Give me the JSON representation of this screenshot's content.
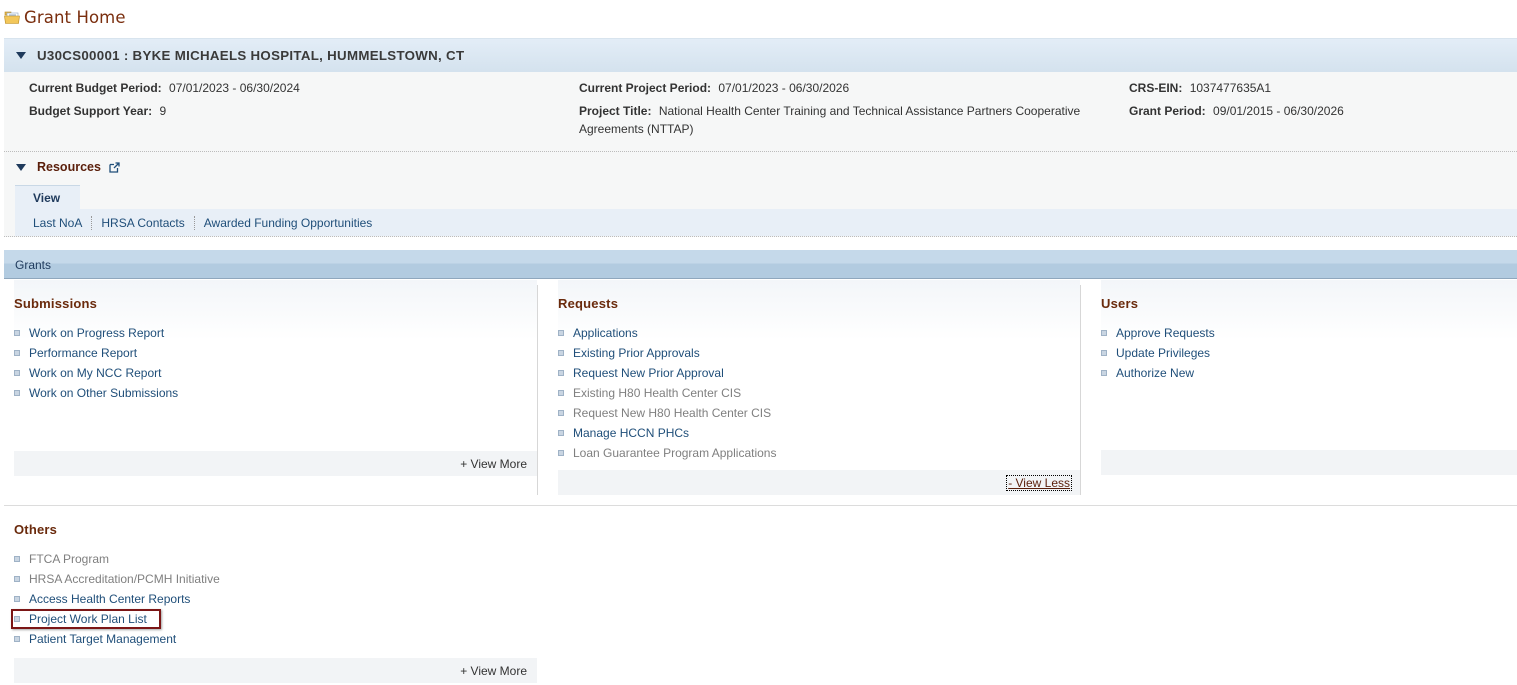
{
  "page": {
    "title": "Grant Home",
    "icon": "folder-icon"
  },
  "grant": {
    "title": "U30CS00001 : BYKE MICHAELS HOSPITAL, HUMMELSTOWN, CT",
    "details": {
      "current_budget_period": {
        "label": "Current Budget Period:",
        "value": "07/01/2023 - 06/30/2024"
      },
      "budget_support_year": {
        "label": "Budget Support Year:",
        "value": "9"
      },
      "current_project_period": {
        "label": "Current Project Period:",
        "value": "07/01/2023 - 06/30/2026"
      },
      "project_title": {
        "label": "Project Title:",
        "value": "National Health Center Training and Technical Assistance Partners Cooperative",
        "value_line2": "Agreements (NTTAP)"
      },
      "crs_ein": {
        "label": "CRS-EIN:",
        "value": "1037477635A1"
      },
      "grant_period": {
        "label": "Grant Period:",
        "value": "09/01/2015 - 06/30/2026"
      }
    }
  },
  "resources": {
    "label": "Resources",
    "tab": "View",
    "links": [
      "Last NoA",
      "HRSA Contacts",
      "Awarded Funding Opportunities"
    ]
  },
  "grants": {
    "bar_label": "Grants",
    "submissions": {
      "heading": "Submissions",
      "items": [
        {
          "label": "Work on Progress Report",
          "enabled": true
        },
        {
          "label": "Performance Report",
          "enabled": true
        },
        {
          "label": "Work on My NCC Report",
          "enabled": true
        },
        {
          "label": "Work on Other Submissions",
          "enabled": true
        }
      ],
      "toggle": "+ View More"
    },
    "requests": {
      "heading": "Requests",
      "items": [
        {
          "label": "Applications",
          "enabled": true
        },
        {
          "label": "Existing Prior Approvals",
          "enabled": true
        },
        {
          "label": "Request New Prior Approval",
          "enabled": true
        },
        {
          "label": "Existing H80 Health Center CIS",
          "enabled": false
        },
        {
          "label": "Request New H80 Health Center CIS",
          "enabled": false
        },
        {
          "label": "Manage HCCN PHCs",
          "enabled": true
        },
        {
          "label": "Loan Guarantee Program Applications",
          "enabled": false
        }
      ],
      "toggle": "- View Less"
    },
    "users": {
      "heading": "Users",
      "items": [
        {
          "label": "Approve Requests",
          "enabled": true
        },
        {
          "label": "Update Privileges",
          "enabled": true
        },
        {
          "label": "Authorize New",
          "enabled": true
        }
      ]
    }
  },
  "others": {
    "heading": "Others",
    "items": [
      {
        "label": "FTCA Program",
        "enabled": false
      },
      {
        "label": "HRSA Accreditation/PCMH Initiative",
        "enabled": false
      },
      {
        "label": "Access Health Center Reports",
        "enabled": true
      },
      {
        "label": "Project Work Plan List",
        "enabled": true,
        "highlighted": true
      },
      {
        "label": "Patient Target Management",
        "enabled": true
      }
    ],
    "toggle": "+ View More"
  },
  "colors": {
    "heading_brown": "#6a2a0c",
    "link_blue": "#1f4e79",
    "disabled_gray": "#7f7f7f",
    "highlight_red": "#7b1616"
  }
}
